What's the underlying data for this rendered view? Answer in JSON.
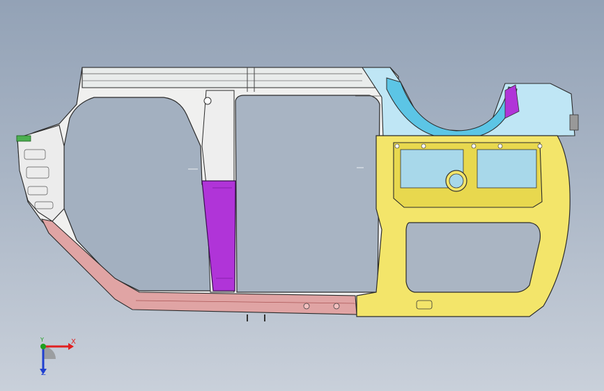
{
  "viewport": {
    "background_top": "#93a2b6",
    "background_bottom": "#c9d0da",
    "part": {
      "name": "body-side-inner-panel",
      "colors": {
        "outline": "#2b2b2b",
        "white_panel": "#f2f2f2",
        "yellow_panel": "#f3e56a",
        "pink_sill": "#e0a4a4",
        "purple_pillar": "#b034d8",
        "cyan_panel": "#a9ddf2",
        "blue_panel": "#bfe6f5"
      }
    }
  },
  "triad": {
    "x_label": "X",
    "y_label": "Y",
    "z_label": "Z",
    "x_color": "#e02020",
    "y_color": "#1fa01f",
    "z_color": "#2040d0"
  }
}
